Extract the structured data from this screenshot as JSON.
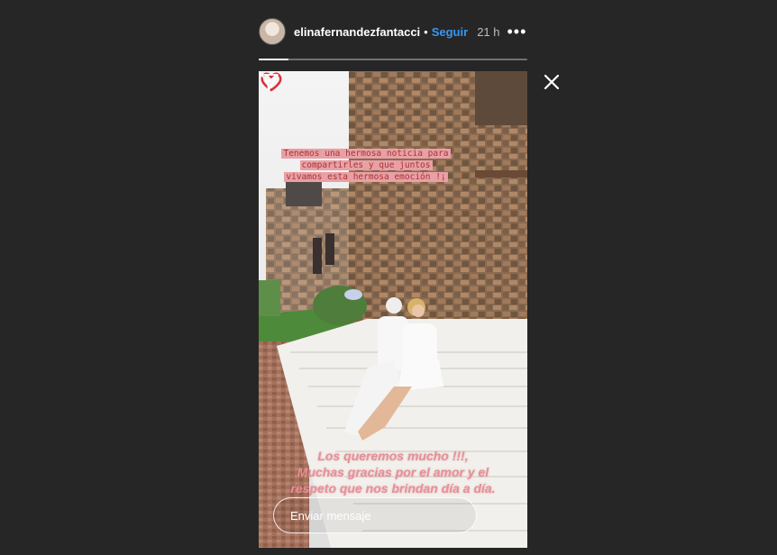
{
  "header": {
    "username": "elinafernandezfantacci",
    "separator": "•",
    "follow_label": "Seguir",
    "time": "21 h",
    "more_label": "•••"
  },
  "story": {
    "progress": 0.11,
    "top_caption": [
      "Tenemos una hermosa noticia para",
      "compartirles y que juntos",
      "vivamos esta hermosa emoción !¡"
    ],
    "bottom_caption": [
      "Los queremos mucho !!!,",
      "Muchas gracias por el amor y el",
      "respeto que nos brindan día a día."
    ]
  },
  "reply": {
    "placeholder": "Enviar mensaje"
  },
  "icons": {
    "close": "close-icon",
    "more": "more-options-icon",
    "send": "send-icon",
    "heart": "heart-sticker-icon"
  },
  "colors": {
    "background": "#262626",
    "follow": "#3897f0",
    "caption_pink": "#e78f97"
  }
}
